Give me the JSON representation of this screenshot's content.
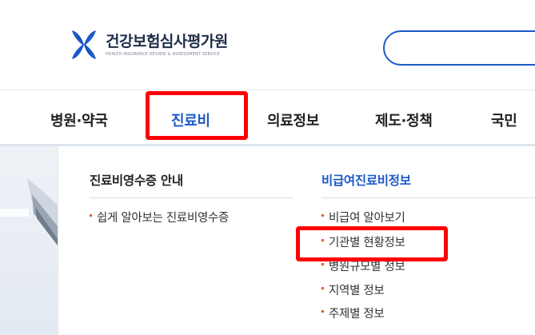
{
  "header": {
    "logo_ko": "건강보험심사평가원",
    "logo_en": "HEALTH INSURANCE REVIEW & ASSESSMENT SERVICE"
  },
  "gnb": {
    "items": [
      {
        "label": "병원·약국"
      },
      {
        "label": "진료비"
      },
      {
        "label": "의료정보"
      },
      {
        "label": "제도·정책"
      },
      {
        "label": "국민"
      }
    ]
  },
  "menu": {
    "col1": {
      "title": "진료비영수증 안내",
      "items": [
        "쉽게 알아보는 진료비영수증"
      ]
    },
    "col2": {
      "title": "비급여진료비정보",
      "items": [
        "비급여 알아보기",
        "기관별 현황정보",
        "병원규모별 정보",
        "지역별 정보",
        "주제별 정보"
      ]
    }
  },
  "colors": {
    "accent": "#1c59c9",
    "highlight": "#ff0000",
    "bullet": "#e55a2b"
  }
}
